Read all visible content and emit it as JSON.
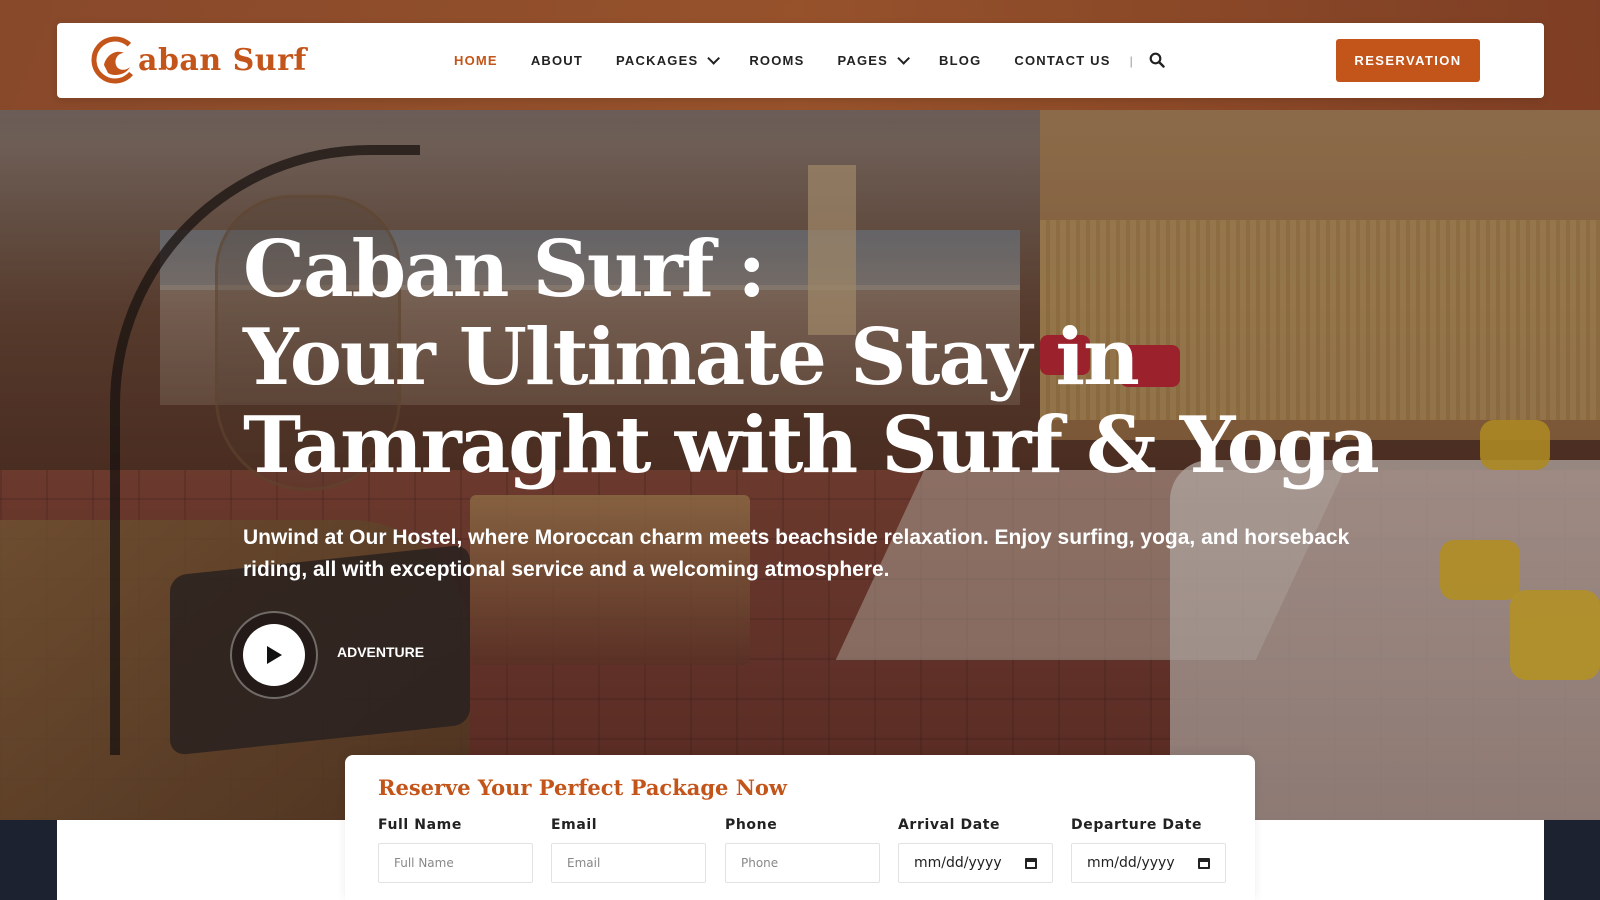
{
  "brand": {
    "logo_text": "aban Surf",
    "accent": "#c4551a"
  },
  "nav": {
    "items": [
      {
        "label": "HOME",
        "active": true,
        "dropdown": false
      },
      {
        "label": "ABOUT",
        "active": false,
        "dropdown": false
      },
      {
        "label": "PACKAGES",
        "active": false,
        "dropdown": true
      },
      {
        "label": "ROOMS",
        "active": false,
        "dropdown": false
      },
      {
        "label": "PAGES",
        "active": false,
        "dropdown": true
      },
      {
        "label": "BLOG",
        "active": false,
        "dropdown": false
      },
      {
        "label": "CONTACT US",
        "active": false,
        "dropdown": false
      }
    ],
    "separator": "|",
    "search_icon": "search-icon",
    "cta_label": "RESERVATION"
  },
  "hero": {
    "title_line1": "Caban Surf :",
    "title_line2": "Your Ultimate Stay in",
    "title_line3": "Tamraght with Surf & Yoga",
    "subtitle": "Unwind at Our Hostel, where Moroccan charm meets beachside relaxation. Enjoy surfing, yoga, and horseback riding, all with exceptional service and a welcoming atmosphere.",
    "play_icon": "play-icon",
    "play_label": "ADVENTURE"
  },
  "reservation": {
    "title": "Reserve Your Perfect Package Now",
    "fields": [
      {
        "label": "Full Name",
        "placeholder": "Full Name"
      },
      {
        "label": "Email",
        "placeholder": "Email"
      },
      {
        "label": "Phone",
        "placeholder": "Phone"
      },
      {
        "label": "Arrival Date",
        "value": "mm/dd/yyyy"
      },
      {
        "label": "Departure Date",
        "value": "mm/dd/yyyy"
      }
    ]
  }
}
